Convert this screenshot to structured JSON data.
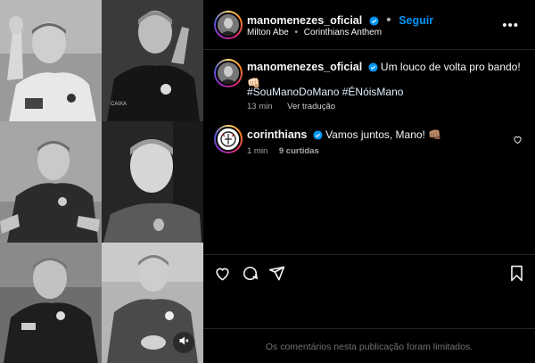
{
  "post": {
    "author": "manomenezes_oficial",
    "follow_label": "Seguir",
    "location": "Milton Abe",
    "audio": "Corinthians Anthem",
    "more_label": "•••",
    "caption": {
      "username": "manomenezes_oficial",
      "text": "Um louco de volta pro bando! 👊🏻",
      "hashtags": "#SouManoDoMano #ÉNóisMano",
      "time": "13 min",
      "translate_label": "Ver tradução"
    },
    "comment": {
      "username": "corinthians",
      "text": "Vamos juntos, Mano! 👊🏽",
      "time": "1 min",
      "likes": "9 curtidas"
    },
    "footer_notice": "Os comentários nesta publicação foram limitados."
  },
  "icons": [
    "verified-icon",
    "more-icon",
    "heart-icon",
    "comment-icon",
    "share-icon",
    "save-icon",
    "mute-icon"
  ],
  "colors": {
    "link_blue": "#0095f6",
    "background": "#000000",
    "muted_text": "#a8a8a8",
    "border": "#262626"
  }
}
